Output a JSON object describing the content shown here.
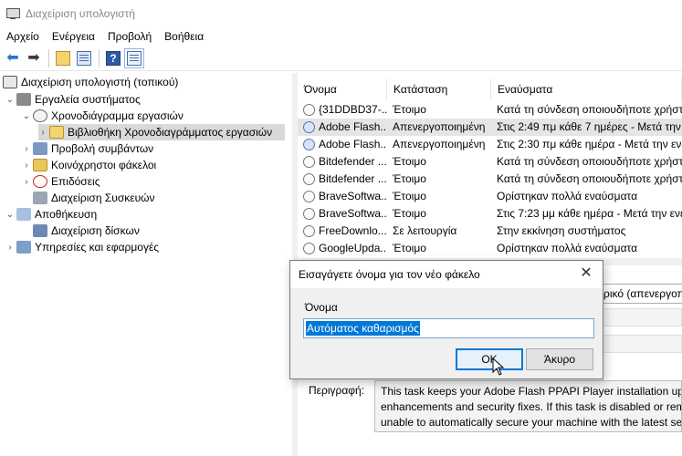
{
  "window": {
    "title": "Διαχείριση υπολογιστή"
  },
  "menu": [
    "Αρχείο",
    "Ενέργεια",
    "Προβολή",
    "Βοήθεια"
  ],
  "toolbar": {
    "icons": [
      "back-arrow-icon",
      "forward-arrow-icon",
      "up-folder-icon",
      "show-hide-tree-icon",
      "help-icon",
      "show-action-pane-icon"
    ]
  },
  "tree": {
    "root": "Διαχείριση υπολογιστή (τοπικού)",
    "system_tools": "Εργαλεία συστήματος",
    "task_scheduler": "Χρονοδιάγραμμα εργασιών",
    "task_library": "Βιβλιοθήκη Χρονοδιαγράμματος εργασιών",
    "event_viewer": "Προβολή συμβάντων",
    "shared_folders": "Κοινόχρηστοι φάκελοι",
    "performance": "Επιδόσεις",
    "device_manager": "Διαχείριση Συσκευών",
    "storage": "Αποθήκευση",
    "disk_management": "Διαχείριση δίσκων",
    "services": "Υπηρεσίες και εφαρμογές"
  },
  "list": {
    "headers": {
      "name": "Όνομα",
      "status": "Κατάσταση",
      "triggers": "Εναύσματα"
    },
    "rows": [
      {
        "name": "{31DDBD37-...",
        "status": "Έτοιμο",
        "trigger": "Κατά τη σύνδεση οποιουδήποτε χρήστη"
      },
      {
        "name": "Adobe Flash...",
        "status": "Απενεργοποιημένη",
        "trigger": "Στις 2:49 πμ κάθε 7 ημέρες - Μετά την ενεργ"
      },
      {
        "name": "Adobe Flash...",
        "status": "Απενεργοποιημένη",
        "trigger": "Στις 2:30 πμ κάθε ημέρα - Μετά την ενεργ"
      },
      {
        "name": "Bitdefender ...",
        "status": "Έτοιμο",
        "trigger": "Κατά τη σύνδεση οποιουδήποτε χρήστη"
      },
      {
        "name": "Bitdefender ...",
        "status": "Έτοιμο",
        "trigger": "Κατά τη σύνδεση οποιουδήποτε χρήστη"
      },
      {
        "name": "BraveSoftwa...",
        "status": "Έτοιμο",
        "trigger": "Ορίστηκαν πολλά εναύσματα"
      },
      {
        "name": "BraveSoftwa...",
        "status": "Έτοιμο",
        "trigger": "Στις 7:23 μμ κάθε ημέρα - Μετά την ενεργ"
      },
      {
        "name": "FreeDownlo...",
        "status": "Σε λειτουργία",
        "trigger": "Στην εκκίνηση συστήματος"
      },
      {
        "name": "GoogleUpda...",
        "status": "Έτοιμο",
        "trigger": "Ορίστηκαν πολλά εναύσματα"
      }
    ]
  },
  "details": {
    "combo_text": "ρικό (απενεργοπ",
    "description_label": "Περιγραφή:",
    "description_lines": [
      "This task keeps your Adobe Flash PPAPI Player installation up to date",
      "enhancements and security fixes. If this task is disabled or removed",
      "unable to automatically secure your machine with the latest securi"
    ]
  },
  "dialog": {
    "title": "Εισαγάγετε όνομα για τον νέο φάκελο",
    "field_label": "Όνομα",
    "input_value": "Αυτόματος καθαρισμός",
    "ok_label": "OK",
    "cancel_label": "Άκυρο"
  }
}
